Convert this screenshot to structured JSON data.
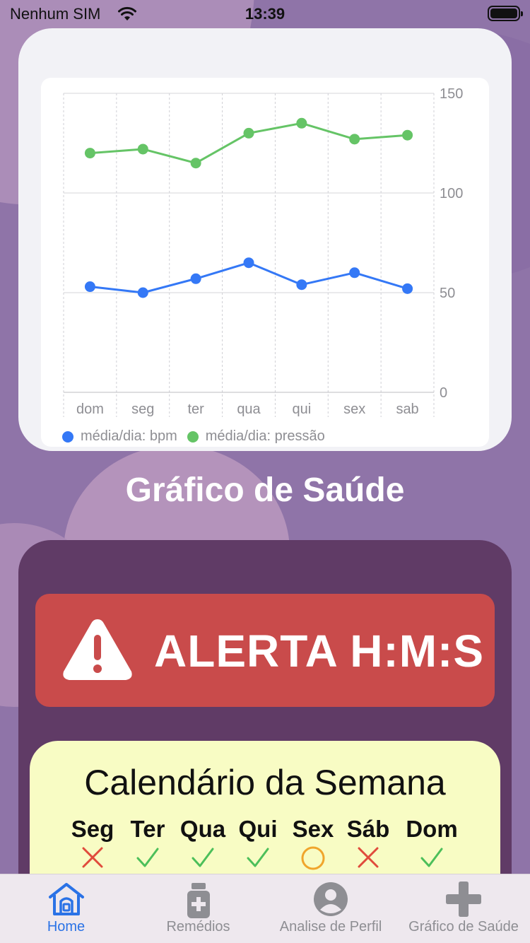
{
  "status_bar": {
    "carrier": "Nenhum SIM",
    "time": "13:39"
  },
  "chart_data": {
    "type": "line",
    "categories": [
      "dom",
      "seg",
      "ter",
      "qua",
      "qui",
      "sex",
      "sab"
    ],
    "series": [
      {
        "name": "média/dia: bpm",
        "color": "#3478f6",
        "values": [
          53,
          50,
          57,
          65,
          54,
          60,
          52
        ]
      },
      {
        "name": "média/dia: pressão",
        "color": "#65c466",
        "values": [
          120,
          122,
          115,
          130,
          135,
          127,
          129
        ]
      }
    ],
    "y_ticks": [
      0,
      50,
      100,
      150
    ],
    "ylim": [
      0,
      150
    ],
    "grid": true,
    "y_axis_side": "right",
    "legend_position": "bottom-left"
  },
  "section_title": "Gráfico de Saúde",
  "alert": {
    "label": "ALERTA H:M:S",
    "color": "#c94b4b",
    "icon": "warning-triangle-icon"
  },
  "calendar": {
    "title": "Calendário da Semana",
    "days": [
      {
        "label": "Seg",
        "status": "missed"
      },
      {
        "label": "Ter",
        "status": "done"
      },
      {
        "label": "Qua",
        "status": "done"
      },
      {
        "label": "Qui",
        "status": "done"
      },
      {
        "label": "Sex",
        "status": "pending"
      },
      {
        "label": "Sáb",
        "status": "missed"
      },
      {
        "label": "Dom",
        "status": "done"
      }
    ],
    "status_colors": {
      "missed": "#e04b3c",
      "done": "#4cbf5a",
      "pending": "#f0a52c"
    }
  },
  "tabs": [
    {
      "label": "Home",
      "icon": "home-icon",
      "active": true
    },
    {
      "label": "Remédios",
      "icon": "medicine-bottle-icon",
      "active": false
    },
    {
      "label": "Analise de Perfil",
      "icon": "profile-icon",
      "active": false
    },
    {
      "label": "Gráfico de Saúde",
      "icon": "plus-icon",
      "active": false
    }
  ],
  "colors": {
    "accent": "#2a72e6",
    "tab_inactive": "#8e8e93",
    "panel": "#603b66"
  }
}
